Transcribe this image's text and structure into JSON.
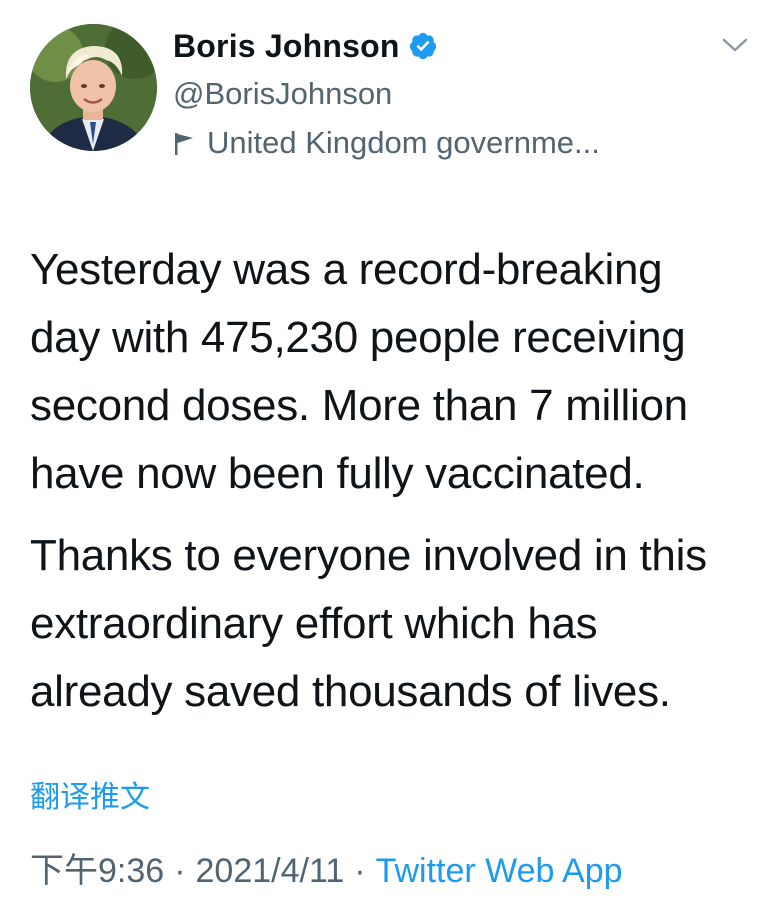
{
  "author": {
    "display_name": "Boris Johnson",
    "handle": "@BorisJohnson",
    "label": "United Kingdom governme...",
    "icons": {
      "verified": "verified-badge-icon",
      "label": "flag-icon",
      "menu": "chevron-down-icon"
    }
  },
  "tweet": {
    "paragraphs": [
      "Yesterday was a record-breaking\nday with 475,230 people receiving\nsecond doses. More than 7 million\nhave now been fully vaccinated.",
      "Thanks to everyone involved in this\nextraordinary effort which has\nalready saved thousands of lives."
    ],
    "translate_label": "翻译推文"
  },
  "meta": {
    "time": "下午9:36",
    "separator": "·",
    "date": "2021/4/11",
    "source": "Twitter Web App"
  },
  "colors": {
    "text": "#0f1419",
    "secondary": "#536471",
    "link": "#1d9bf0",
    "verified": "#1d9bf0"
  }
}
